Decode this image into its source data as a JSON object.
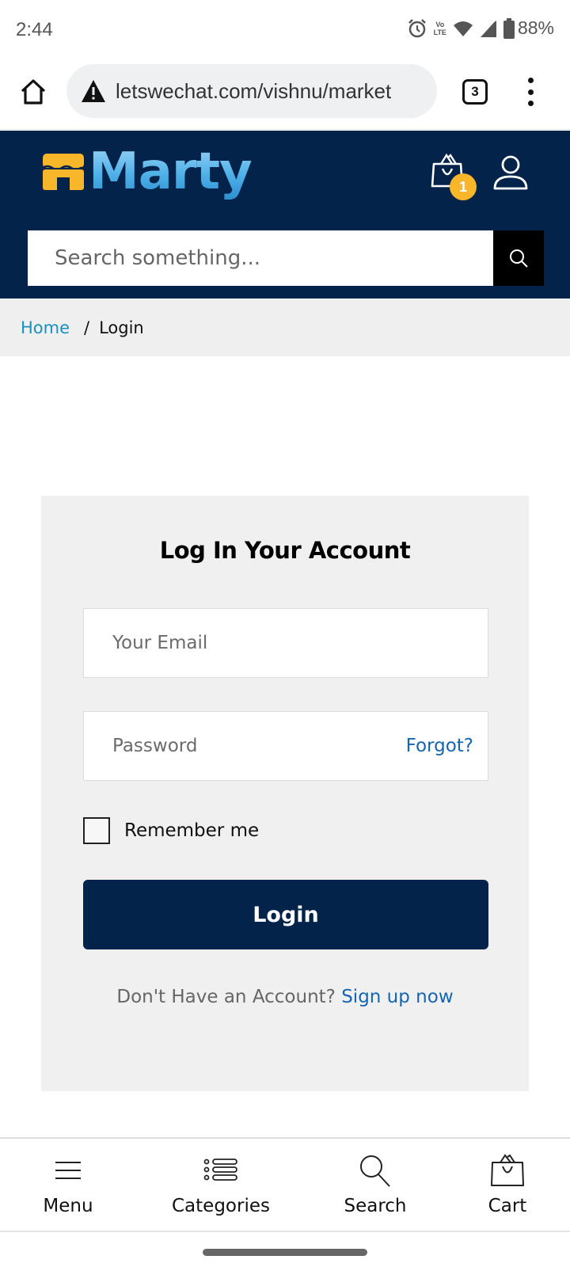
{
  "status_bar": {
    "time": "2:44",
    "icons": [
      "alarm-icon",
      "volte-icon",
      "wifi-icon",
      "signal-icon",
      "battery-icon"
    ],
    "volte_top": "Vo",
    "volte_bottom": "LTE",
    "battery": "88%"
  },
  "browser": {
    "url": "letswechat.com/vishnu/market",
    "security_icon": "warning-icon",
    "tab_count": "3"
  },
  "header": {
    "logo_text": "Marty",
    "cart_badge": "1",
    "search_placeholder": "Search something...",
    "colors": {
      "header_bg": "#03234a",
      "badge": "#f8b62a",
      "logo_mark": "#f8b62a"
    }
  },
  "breadcrumb": {
    "home": "Home",
    "separator": "/",
    "current": "Login"
  },
  "login": {
    "title": "Log In Your Account",
    "email_placeholder": "Your Email",
    "email_value": "",
    "password_placeholder": "Password",
    "password_value": "",
    "forgot_label": "Forgot?",
    "remember_label": "Remember me",
    "remember_checked": false,
    "login_button": "Login",
    "no_account_text": "Don't Have an Account?",
    "signup_link": "Sign up now",
    "colors": {
      "button": "#03234a",
      "link": "#1565b0"
    }
  },
  "bottom_nav": {
    "items": [
      {
        "label": "Menu",
        "icon": "hamburger-icon"
      },
      {
        "label": "Categories",
        "icon": "list-icon"
      },
      {
        "label": "Search",
        "icon": "search-icon"
      },
      {
        "label": "Cart",
        "icon": "shopping-bag-icon"
      }
    ]
  }
}
